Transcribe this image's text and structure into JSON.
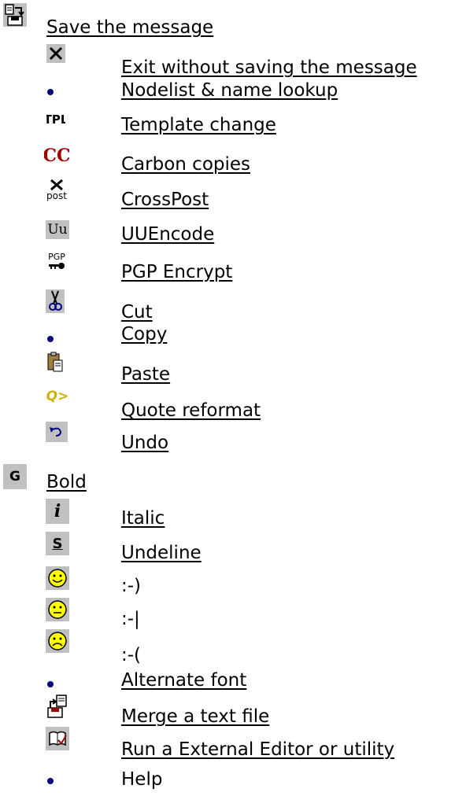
{
  "items": [
    {
      "label": "Save the message",
      "icon": "save-message-icon",
      "link": true
    },
    {
      "label": "Exit without saving the message",
      "icon": "close-icon",
      "link": true
    },
    {
      "label": "Nodelist & name lookup",
      "icon": "bullet-icon",
      "link": true
    },
    {
      "label": "Template change",
      "icon": "template-tpl-icon",
      "icon_text": "TPL",
      "link": true
    },
    {
      "label": "Carbon copies",
      "icon": "carbon-copy-cc-icon",
      "icon_text": "CC",
      "link": true
    },
    {
      "label": "CrossPost",
      "icon": "crosspost-icon",
      "icon_text": "post",
      "link": true
    },
    {
      "label": "UUEncode",
      "icon": "uuencode-icon",
      "icon_text": "Uu",
      "link": true
    },
    {
      "label": "PGP Encrypt",
      "icon": "pgp-key-icon",
      "icon_text": "PGP",
      "link": true
    },
    {
      "label": "Cut",
      "icon": "scissors-icon",
      "link": true
    },
    {
      "label": "Copy",
      "icon": "bullet-icon",
      "link": true
    },
    {
      "label": "Paste",
      "icon": "clipboard-icon",
      "link": true
    },
    {
      "label": "Quote reformat",
      "icon": "quote-reformat-icon",
      "icon_text": "Q>",
      "link": true
    },
    {
      "label": "Undo",
      "icon": "undo-arrow-icon",
      "link": true
    },
    {
      "label": "Bold",
      "icon": "bold-g-icon",
      "icon_text": "G",
      "link": true
    },
    {
      "label": "Italic",
      "icon": "italic-i-icon",
      "icon_text": "i",
      "link": true
    },
    {
      "label": "Undeline",
      "icon": "underline-s-icon",
      "icon_text": "S",
      "link": true
    },
    {
      "label": ":-)",
      "icon": "smiley-happy-icon",
      "link": false
    },
    {
      "label": ":-|",
      "icon": "smiley-neutral-icon",
      "link": false
    },
    {
      "label": ":-(",
      "icon": "smiley-sad-icon",
      "link": false
    },
    {
      "label": "Alternate font",
      "icon": "bullet-icon",
      "link": true
    },
    {
      "label": "Merge a text file",
      "icon": "merge-file-icon",
      "link": true
    },
    {
      "label": "Run a External Editor or utility",
      "icon": "external-editor-icon",
      "link": true
    },
    {
      "label": "Help",
      "icon": "bullet-icon",
      "link": false
    }
  ],
  "colors": {
    "icon_bg": "#c0c0c0",
    "bullet": "#000080",
    "cc_red": "#a00000",
    "quote_yellow": "#d0b000",
    "smiley_yellow": "#ffff00",
    "undo_blue": "#000080"
  }
}
